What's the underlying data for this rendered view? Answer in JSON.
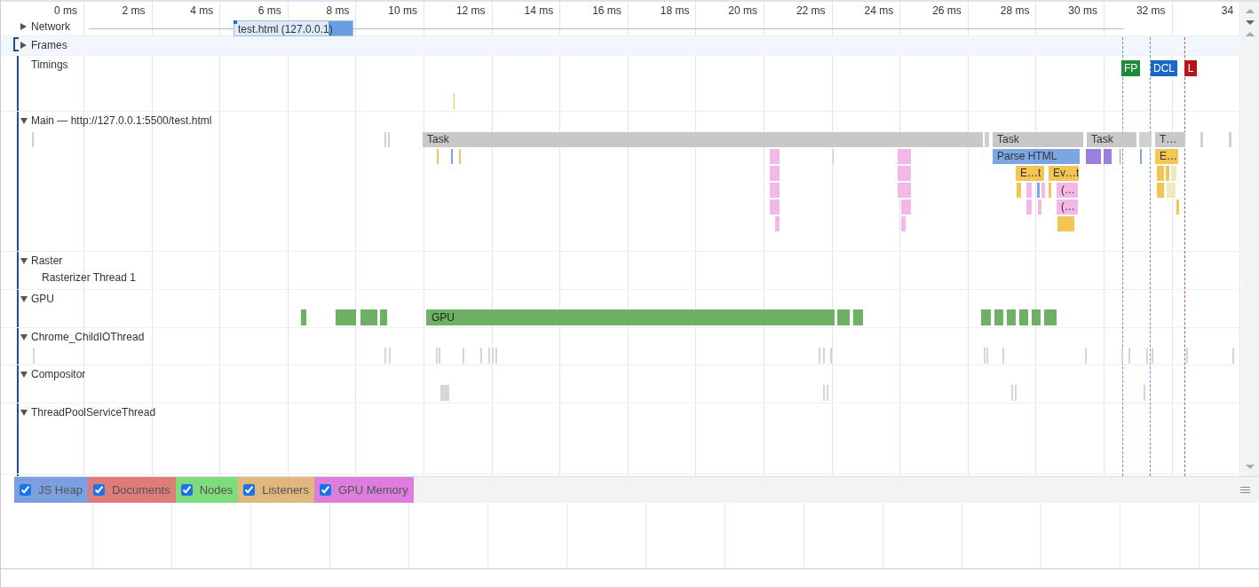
{
  "ruler": {
    "ticks": [
      "0 ms",
      "2 ms",
      "4 ms",
      "6 ms",
      "8 ms",
      "10 ms",
      "12 ms",
      "14 ms",
      "16 ms",
      "18 ms",
      "20 ms",
      "22 ms",
      "24 ms",
      "26 ms",
      "28 ms",
      "30 ms",
      "32 ms",
      "34"
    ]
  },
  "tracks": [
    {
      "name": "Network",
      "expanded": false,
      "selected": false
    },
    {
      "name": "Frames",
      "expanded": false,
      "selected": true
    },
    {
      "name": "Timings",
      "selected": false
    },
    {
      "name": "Main — http://127.0.0.1:5500/test.html",
      "expanded": true,
      "selected": false
    },
    {
      "name": "Raster",
      "expanded": true,
      "selected": false,
      "children": [
        {
          "name": "Rasterizer Thread 1"
        }
      ]
    },
    {
      "name": "GPU",
      "expanded": true,
      "selected": false
    },
    {
      "name": "Chrome_ChildIOThread",
      "expanded": true,
      "selected": false
    },
    {
      "name": "Compositor",
      "expanded": true,
      "selected": false
    },
    {
      "name": "ThreadPoolServiceThread",
      "expanded": true,
      "selected": false
    }
  ],
  "network_request": {
    "label": "test.html (127.0.0.1)"
  },
  "timing_markers": [
    {
      "label": "FP",
      "color": "#1e8a3a"
    },
    {
      "label": "DCL",
      "color": "#1a67c8"
    },
    {
      "label": "L",
      "color": "#b3161b"
    }
  ],
  "main_events": [
    {
      "label": "Task",
      "color": "#c8c8c8"
    },
    {
      "label": "Task",
      "color": "#c8c8c8"
    },
    {
      "label": "Task",
      "color": "#c8c8c8"
    },
    {
      "label": "T…",
      "color": "#c8c8c8"
    },
    {
      "label": "Parse HTML",
      "color": "#7ba6e3"
    },
    {
      "label": "E…t",
      "color": "#f2c554"
    },
    {
      "label": "Ev…t",
      "color": "#f2c554"
    },
    {
      "label": "(…",
      "color": "#f3b8e8"
    },
    {
      "label": "(…",
      "color": "#f3b8e8"
    },
    {
      "label": "E…",
      "color": "#f2c554"
    }
  ],
  "gpu_events": [
    {
      "label": "GPU"
    }
  ],
  "counters": [
    {
      "label": "JS Heap",
      "checked": true,
      "color": "#7c9fe0"
    },
    {
      "label": "Documents",
      "checked": true,
      "color": "#e07c78"
    },
    {
      "label": "Nodes",
      "checked": true,
      "color": "#7fdc7c"
    },
    {
      "label": "Listeners",
      "checked": true,
      "color": "#e2b77e"
    },
    {
      "label": "GPU Memory",
      "checked": true,
      "color": "#dd7ede"
    }
  ]
}
